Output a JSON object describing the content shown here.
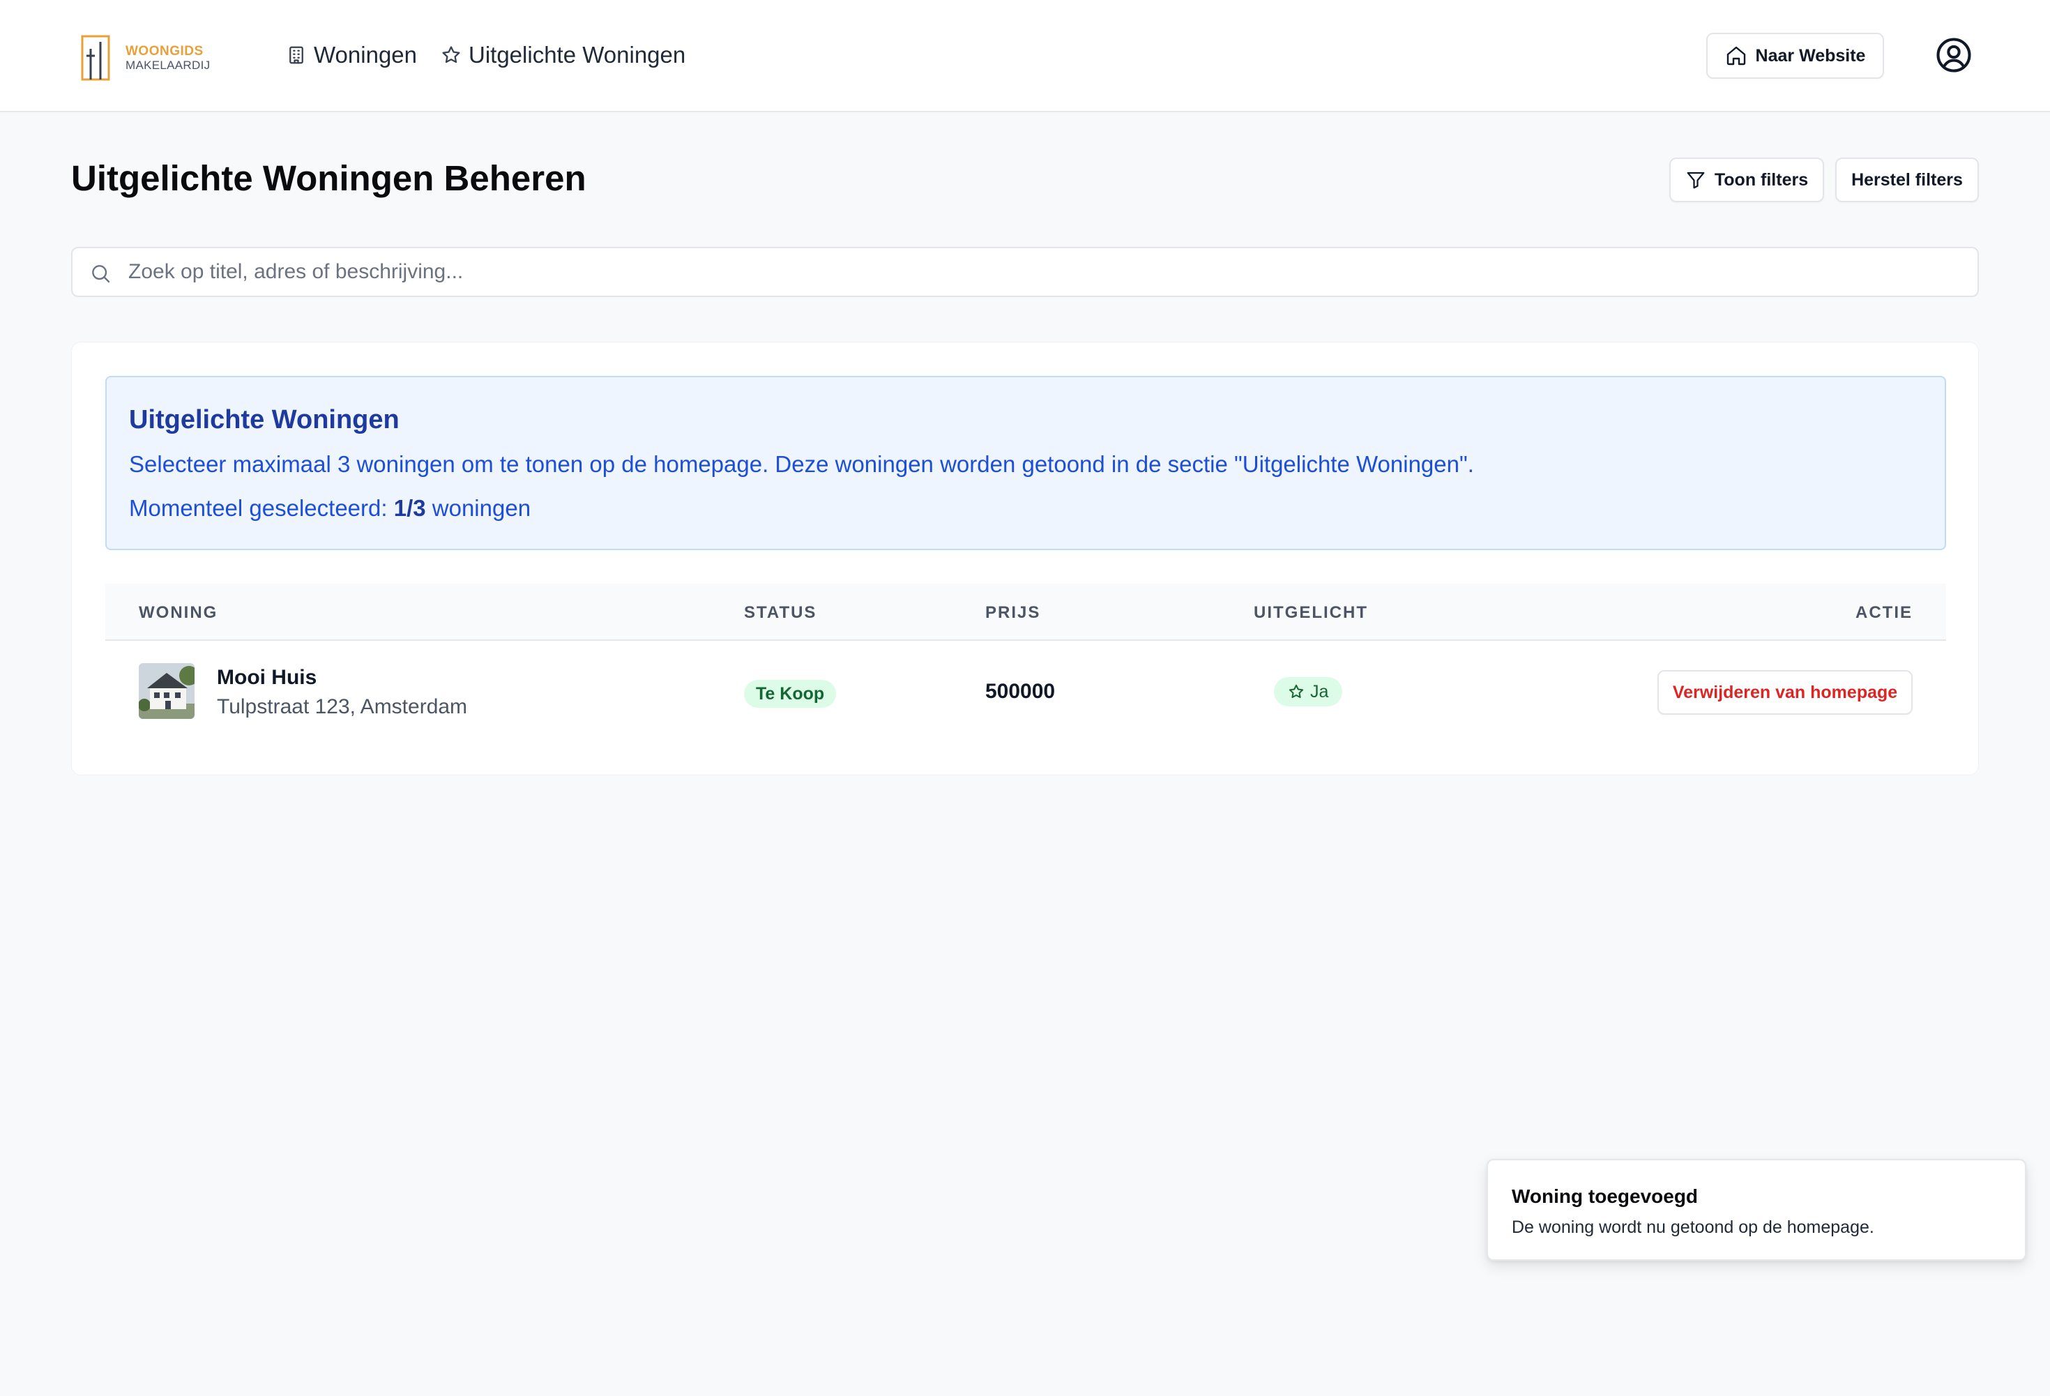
{
  "brand": {
    "name": "WOONGIDS",
    "sub": "MAKELAARDIJ",
    "color": "#e7a13a"
  },
  "nav": {
    "items": [
      {
        "label": "Woningen",
        "icon": "building-icon"
      },
      {
        "label": "Uitgelichte Woningen",
        "icon": "star-icon"
      }
    ],
    "website_button": "Naar Website",
    "account_icon": "user-circle-icon"
  },
  "page": {
    "title": "Uitgelichte Woningen Beheren",
    "show_filters": "Toon filters",
    "reset_filters": "Herstel filters"
  },
  "search": {
    "placeholder": "Zoek op titel, adres of beschrijving...",
    "value": ""
  },
  "info": {
    "title": "Uitgelichte Woningen",
    "text": "Selecteer maximaal 3 woningen om te tonen op de homepage. Deze woningen worden getoond in de sectie \"Uitgelichte Woningen\".",
    "count_prefix": "Momenteel geselecteerd:",
    "count": "1/3",
    "count_suffix": "woningen"
  },
  "table": {
    "columns": [
      "WONING",
      "STATUS",
      "PRIJS",
      "UITGELICHT",
      "ACTIE"
    ],
    "rows": [
      {
        "title": "Mooi Huis",
        "address": "Tulpstraat 123, Amsterdam",
        "status": "Te Koop",
        "price": "500000",
        "featured": "Ja",
        "action": "Verwijderen van homepage"
      }
    ]
  },
  "toast": {
    "title": "Woning toegevoegd",
    "description": "De woning wordt nu getoond op de homepage."
  },
  "colors": {
    "info_bg": "#eef5fe",
    "info_text": "#1d4ed8",
    "status_bg": "#dcfce7",
    "status_text": "#166534",
    "danger": "#dc2626"
  }
}
